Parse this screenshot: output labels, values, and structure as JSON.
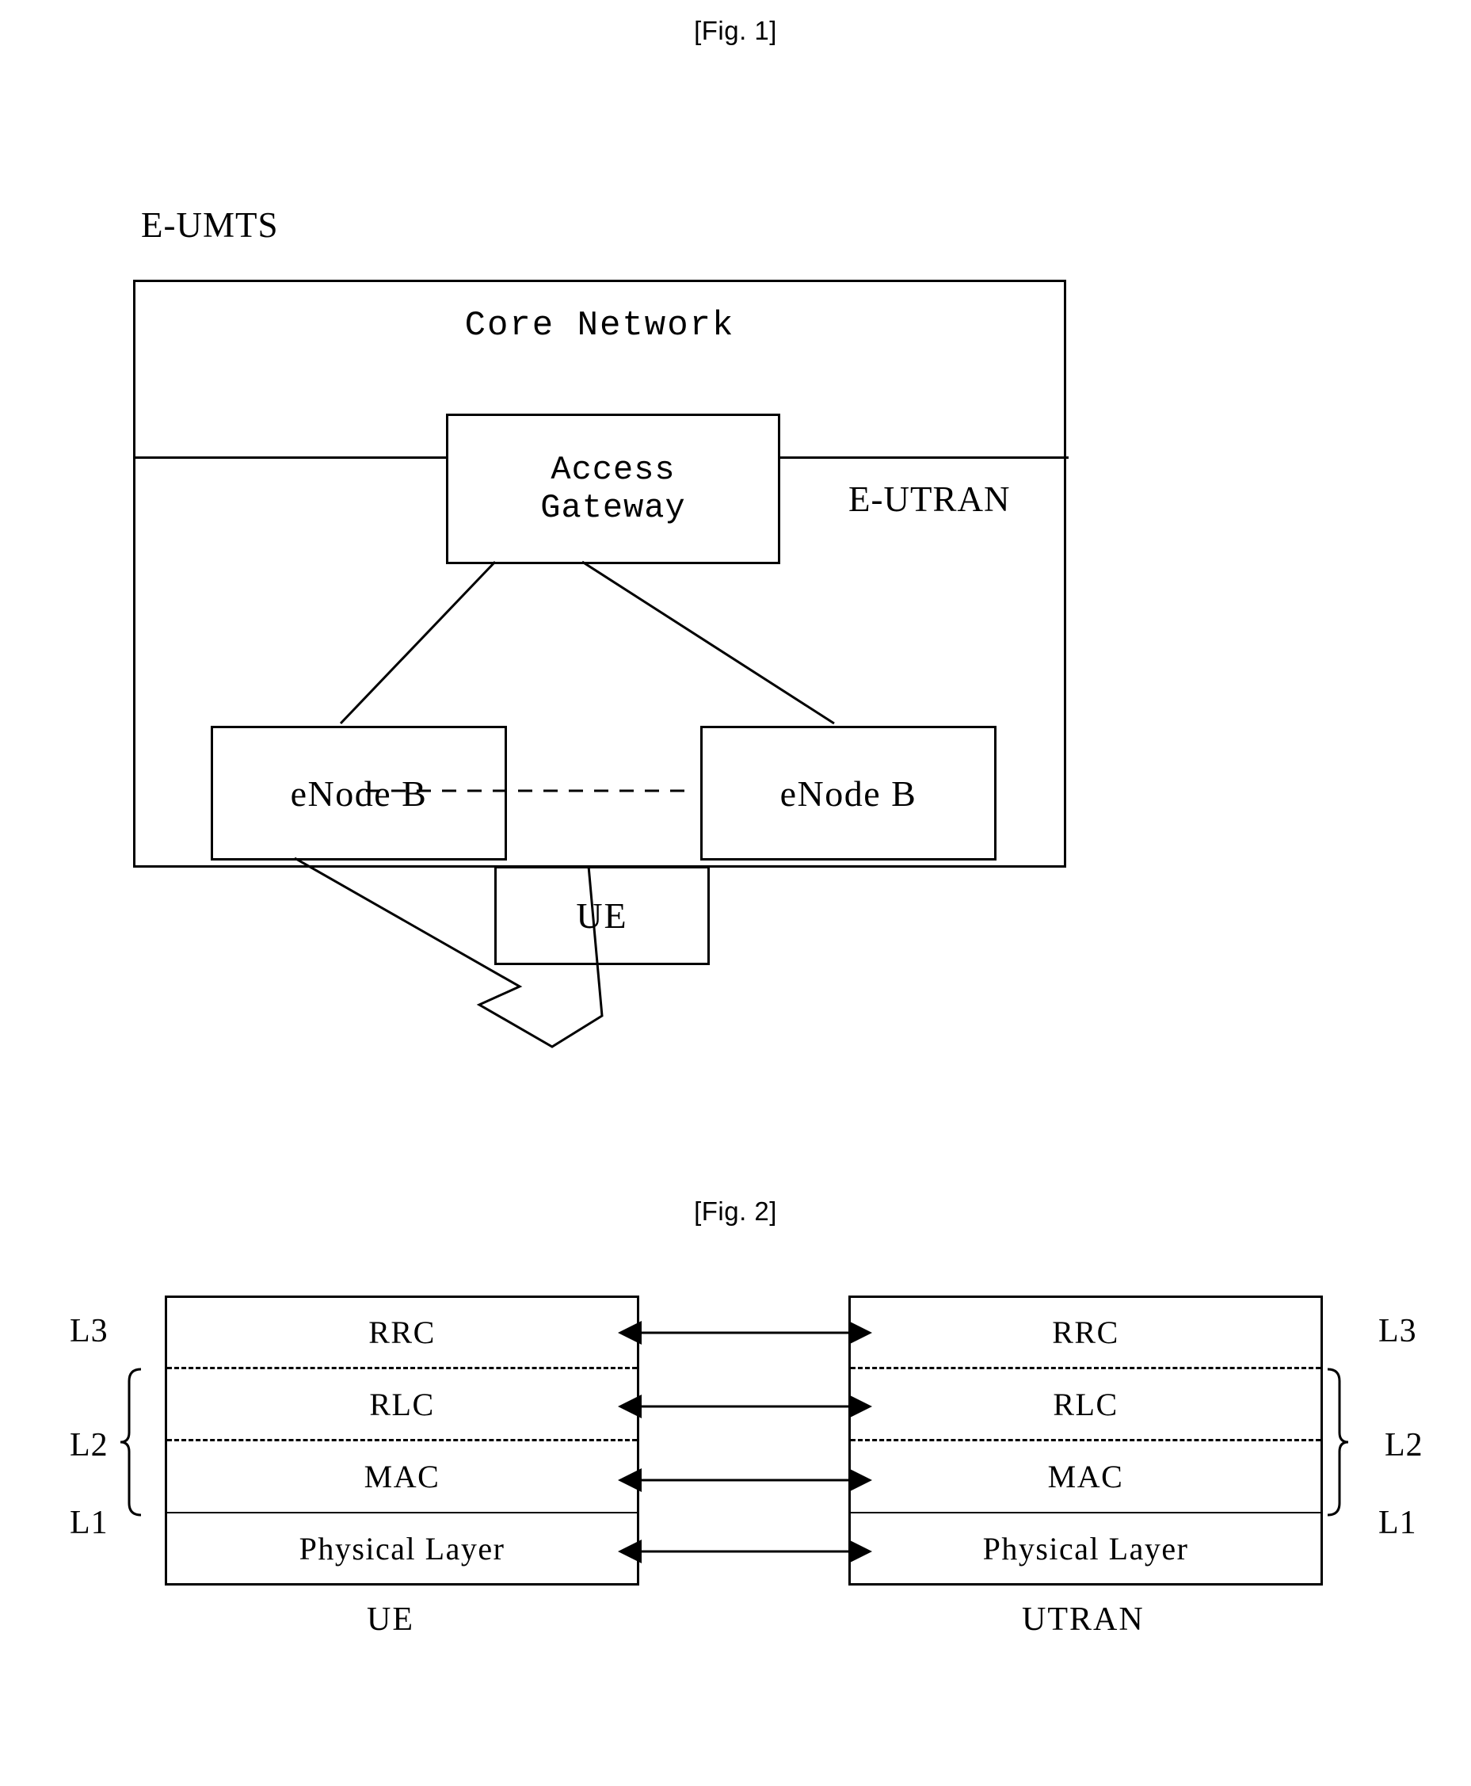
{
  "figures": [
    {
      "caption": "[Fig. 1]",
      "system_label": "E-UMTS",
      "core_network_label": "Core Network",
      "eutran_label": "E-UTRAN",
      "access_gateway": {
        "line1": "Access",
        "line2": "Gateway"
      },
      "enode_b_left": "eNode B",
      "enode_b_right": "eNode B",
      "ue": "UE"
    },
    {
      "caption": "[Fig. 2]",
      "left_side_labels": [
        "L3",
        "L2",
        "L1"
      ],
      "right_side_labels": [
        "L3",
        "L2",
        "L1"
      ],
      "stacks": [
        {
          "name": "UE",
          "caption": "UE",
          "layers": [
            "RRC",
            "RLC",
            "MAC",
            "Physical Layer"
          ]
        },
        {
          "name": "UTRAN",
          "caption": "UTRAN",
          "layers": [
            "RRC",
            "RLC",
            "MAC",
            "Physical Layer"
          ]
        }
      ],
      "connections": [
        {
          "layer": "RRC",
          "type": "double-arrow"
        },
        {
          "layer": "RLC",
          "type": "double-arrow"
        },
        {
          "layer": "MAC",
          "type": "double-arrow"
        },
        {
          "layer": "Physical Layer",
          "type": "double-arrow"
        }
      ]
    }
  ],
  "colors": {
    "ink": "#000000",
    "paper": "#ffffff"
  }
}
